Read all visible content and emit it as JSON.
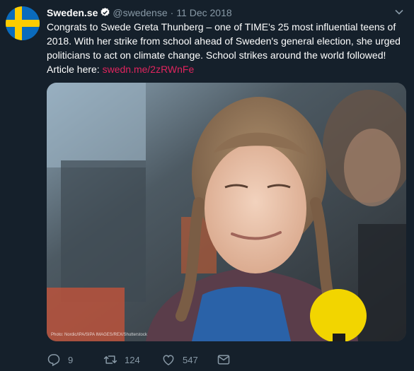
{
  "tweet": {
    "author_name": "Sweden.se",
    "handle": "@swedense",
    "separator": "·",
    "date": "11 Dec 2018",
    "text": "Congrats to Swede Greta Thunberg – one of TIME's 25 most influential teens of 2018. With her strike from school ahead of Sweden's general election, she urged politicians to act on climate change. School strikes around the world followed!",
    "article_prefix": "Article here: ",
    "link": "swedn.me/2zRWnFe",
    "photo_credit": "Photo: Nordic/IPA/SIPA IMAGES/REX/Shutterstock"
  },
  "actions": {
    "reply_count": "9",
    "retweet_count": "124",
    "like_count": "547"
  },
  "colors": {
    "background": "#15202b",
    "secondary_text": "#8899a6",
    "link": "#e0245e",
    "verified": "#1da1f2"
  },
  "icons": [
    "sweden-flag-avatar",
    "verified-badge-icon",
    "chevron-down-icon",
    "reply-icon",
    "retweet-icon",
    "like-icon",
    "dm-icon"
  ]
}
